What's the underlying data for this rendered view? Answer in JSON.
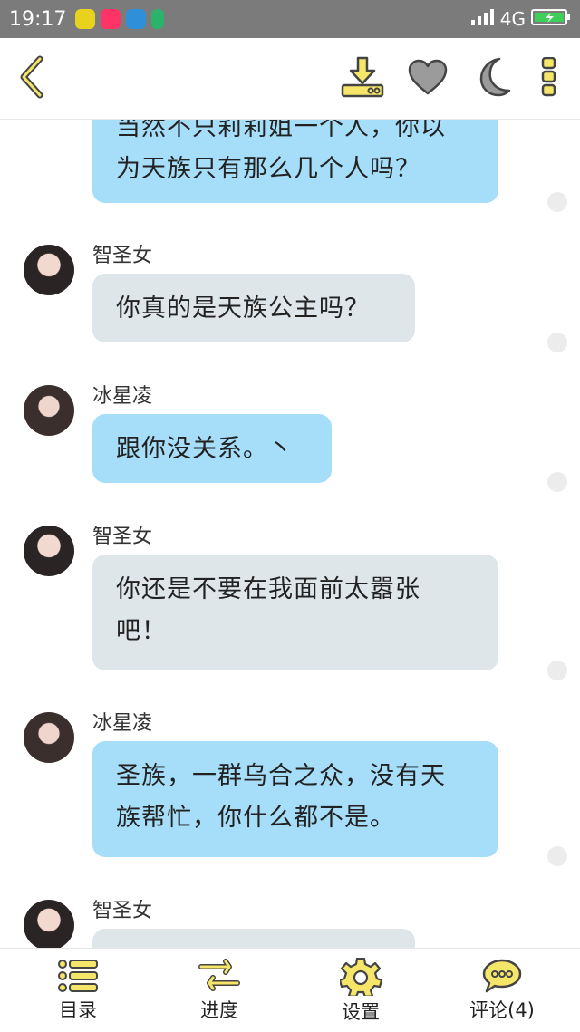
{
  "status_bar": {
    "time": "19:17",
    "network": "4G"
  },
  "toolbar": {
    "icons": [
      "back-icon",
      "download-icon",
      "heart-icon",
      "moon-icon",
      "more-icon"
    ]
  },
  "messages": [
    {
      "sender": "",
      "text": "当然不只莉莉姐一个人，你以为天族只有那么几个人吗？",
      "line1": "当然不只莉莉姐一个人，你以",
      "line2": "为天族只有那么几个人吗？",
      "side": "blue"
    },
    {
      "sender": "智圣女",
      "line1": "你真的是天族公主吗？",
      "side": "gray"
    },
    {
      "sender": "冰星凌",
      "line1": "跟你没关系。丶",
      "side": "blue"
    },
    {
      "sender": "智圣女",
      "line1": "你还是不要在我面前太嚣张",
      "line2": "吧！",
      "side": "gray"
    },
    {
      "sender": "冰星凌",
      "line1": "圣族，一群乌合之众，没有天",
      "line2": "族帮忙，你什么都不是。",
      "side": "blue"
    },
    {
      "sender": "智圣女",
      "line1": "",
      "side": "gray"
    }
  ],
  "bottom_nav": [
    {
      "label": "目录",
      "icon": "list-icon"
    },
    {
      "label": "进度",
      "icon": "swap-arrows-icon"
    },
    {
      "label": "设置",
      "icon": "gear-icon"
    },
    {
      "label": "评论(4)",
      "icon": "comment-icon"
    }
  ],
  "colors": {
    "accent_yellow": "#f5e66a",
    "icon_stroke": "#444444",
    "bubble_blue": "#a6defa",
    "bubble_gray": "#dfe6ea"
  }
}
